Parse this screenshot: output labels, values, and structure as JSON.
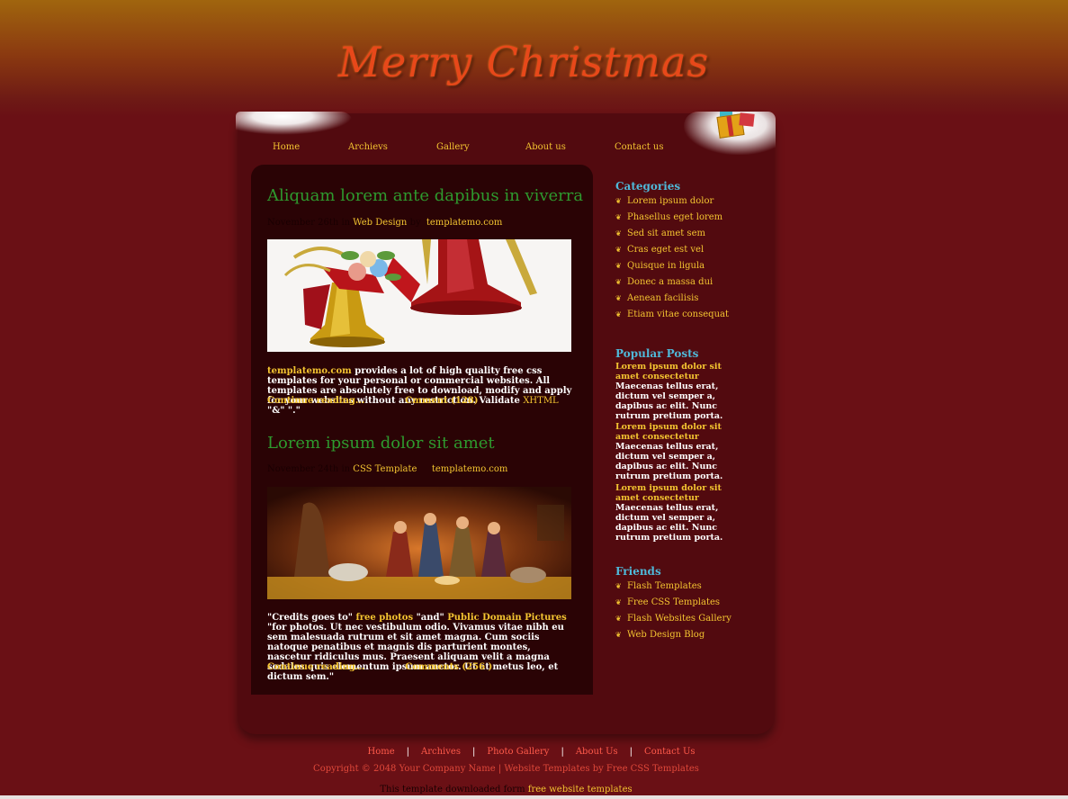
{
  "header": {
    "title": "Merry Christmas"
  },
  "nav": [
    {
      "label": "Home"
    },
    {
      "label": "Archievs"
    },
    {
      "label": "Gallery"
    },
    {
      "label": "About us"
    },
    {
      "label": "Contact us"
    }
  ],
  "posts": [
    {
      "title": "Aliquam lorem ante dapibus in viverra",
      "date": "November 26th in",
      "category": "Web Design",
      "by": "by",
      "author": "templatemo.com",
      "image": "christmas-bells-image",
      "text_link": "templatemo.com",
      "text": "provides a lot of high quality free css templates for your personal or commercial websites. All templates are absolutely free to download, modify and apply for your websites without any restriction. Validate",
      "xhtml": "XHTML",
      "text_tail": "\"&\" \".\"",
      "continue": "Continue reading...",
      "comments": "Cmment (128)"
    },
    {
      "title": "Lorem ipsum dolor sit amet",
      "date": "November 24th in",
      "category": "CSS Template",
      "author": "templatemo.com",
      "image": "nativity-scene-image",
      "text_a": "\"Credits goes to\"",
      "link1": "free photos",
      "text_b": "\"and\"",
      "link2": "Public Domain Pictures",
      "text_c": "\"for photos. Ut nec vestibulum odio. Vivamus vitae nibh eu sem malesuada rutrum et sit amet magna. Cum sociis natoque penatibus et magnis dis parturient montes, nascetur ridiculus mus. Praesent aliquam velit a magna sodales quis elementum ipsum auctor. Ut at metus leo, et dictum sem.\"",
      "continue": "Continue reading...",
      "comments": "Comments (256 )"
    }
  ],
  "sidebar": {
    "categories_title": "Categories",
    "categories": [
      "Lorem ipsum dolor",
      "Phasellus eget lorem",
      "Sed sit amet sem",
      "Cras eget est vel",
      "Quisque in ligula",
      "Donec a massa dui",
      "Aenean facilisis",
      "Etiam vitae consequat"
    ],
    "popular_title": "Popular Posts",
    "popular": [
      {
        "title": "Lorem ipsum dolor sit amet consectetur",
        "body": "Maecenas tellus erat, dictum vel semper a, dapibus ac elit. Nunc rutrum pretium porta."
      },
      {
        "title": "Lorem ipsum dolor sit amet consectetur",
        "body": "Maecenas tellus erat, dictum vel semper a, dapibus ac elit. Nunc rutrum pretium porta."
      },
      {
        "title": "Lorem ipsum dolor sit amet consectetur",
        "body": "Maecenas tellus erat, dictum vel semper a, dapibus ac elit. Nunc rutrum pretium porta."
      }
    ],
    "friends_title": "Friends",
    "friends": [
      "Flash Templates",
      "Free CSS Templates",
      "Flash Websites Gallery",
      "Web Design Blog"
    ]
  },
  "footer": {
    "links": [
      "Home",
      "Archives",
      "Photo Gallery",
      "About Us",
      "Contact Us"
    ],
    "separator": "|",
    "copyright": "Copyright © 2048 Your Company Name | Website Templates by Free CSS Templates",
    "download_text": "This template downloaded form",
    "download_link": "free website templates"
  },
  "colors": {
    "accent": "#f4c531",
    "title_green": "#2e9a2e",
    "sidebar_heading": "#4fb8d8",
    "footer_link": "#ff5a4a",
    "header_title": "#e8481a"
  }
}
